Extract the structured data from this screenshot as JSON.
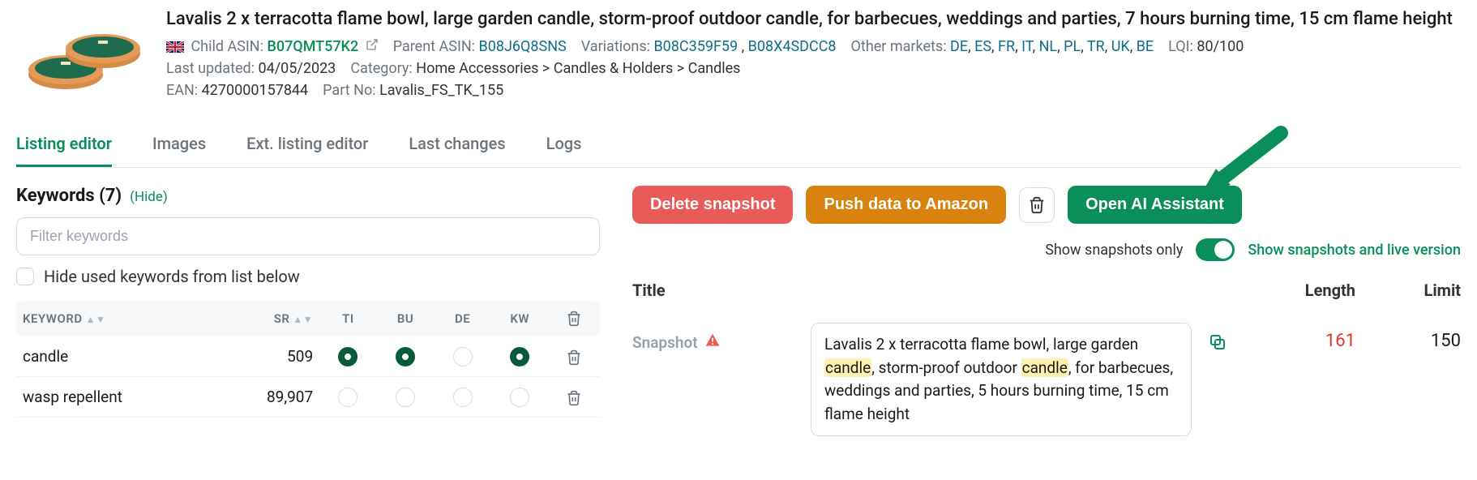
{
  "product": {
    "title": "Lavalis 2 x terracotta flame bowl, large garden candle, storm-proof outdoor candle, for barbecues, weddings and parties, 7 hours burning time, 15 cm flame height",
    "child_asin_label": "Child ASIN:",
    "child_asin": "B07QMT57K2",
    "parent_asin_label": "Parent ASIN:",
    "parent_asin": "B08J6Q8SNS",
    "variations_label": "Variations:",
    "variations": [
      "B08C359F59",
      "B08X4SDCC8"
    ],
    "other_markets_label": "Other markets:",
    "other_markets": [
      "DE",
      "ES",
      "FR",
      "IT",
      "NL",
      "PL",
      "TR",
      "UK",
      "BE"
    ],
    "lqi_label": "LQI:",
    "lqi_value": "80/100",
    "last_updated_label": "Last updated:",
    "last_updated": "04/05/2023",
    "category_label": "Category:",
    "category": "Home Accessories > Candles & Holders > Candles",
    "ean_label": "EAN:",
    "ean": "4270000157844",
    "part_no_label": "Part No:",
    "part_no": "Lavalis_FS_TK_155"
  },
  "tabs": {
    "listing_editor": "Listing editor",
    "images": "Images",
    "ext_listing_editor": "Ext. listing editor",
    "last_changes": "Last changes",
    "logs": "Logs"
  },
  "keywords": {
    "heading": "Keywords (7)",
    "hide": "(Hide)",
    "filter_placeholder": "Filter keywords",
    "hide_used_label": "Hide used keywords from list below",
    "cols": {
      "keyword": "KEYWORD",
      "sr": "SR",
      "ti": "TI",
      "bu": "BU",
      "de": "DE",
      "kw": "KW"
    },
    "rows": [
      {
        "keyword": "candle",
        "sr": "509",
        "ti": true,
        "bu": true,
        "de": false,
        "kw": true
      },
      {
        "keyword": "wasp repellent",
        "sr": "89,907",
        "ti": false,
        "bu": false,
        "de": false,
        "kw": false
      }
    ]
  },
  "actions": {
    "delete_snapshot": "Delete snapshot",
    "push_to_amazon": "Push data to Amazon",
    "open_ai_assistant": "Open AI Assistant"
  },
  "toggle": {
    "left_label": "Show snapshots only",
    "right_label": "Show snapshots and live version"
  },
  "title_section": {
    "title_head": "Title",
    "length_head": "Length",
    "limit_head": "Limit",
    "snapshot_label": "Snapshot",
    "snapshot_text_pre": "Lavalis 2 x terracotta flame bowl, large garden ",
    "snapshot_hl1": "candle",
    "snapshot_text_mid": ", storm-proof outdoor ",
    "snapshot_hl2": "candle",
    "snapshot_text_post": ", for barbecues, weddings and parties, 5 hours burning time, 15 cm flame height",
    "length": "161",
    "limit": "150"
  }
}
